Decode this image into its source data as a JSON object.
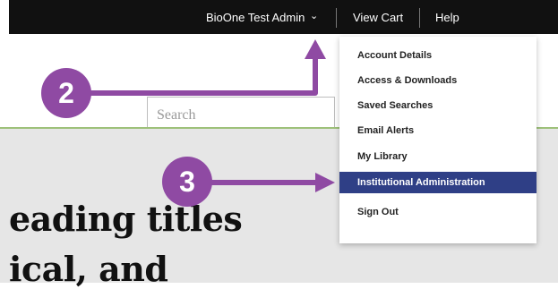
{
  "topbar": {
    "user_label": "BioOne Test Admin",
    "cart_label": "View Cart",
    "help_label": "Help"
  },
  "search": {
    "placeholder": "Search"
  },
  "menu": {
    "items": [
      {
        "label": "Account Details"
      },
      {
        "label": "Access & Downloads"
      },
      {
        "label": "Saved Searches"
      },
      {
        "label": "Email Alerts"
      },
      {
        "label": "My Library"
      },
      {
        "label": "Institutional Administration",
        "highlighted": true
      },
      {
        "label": "Sign Out"
      }
    ]
  },
  "hero": {
    "line1": "eading titles",
    "line2": "ical, and"
  },
  "callouts": {
    "step2": "2",
    "step3": "3"
  },
  "colors": {
    "topbar": "#111111",
    "menu_highlight": "#2f3f86",
    "callout": "#8f4aa3",
    "divider": "#9ec17a",
    "content_bg": "#e6e6e6"
  },
  "icons": {
    "user_dropdown": "chevron-down-icon"
  }
}
